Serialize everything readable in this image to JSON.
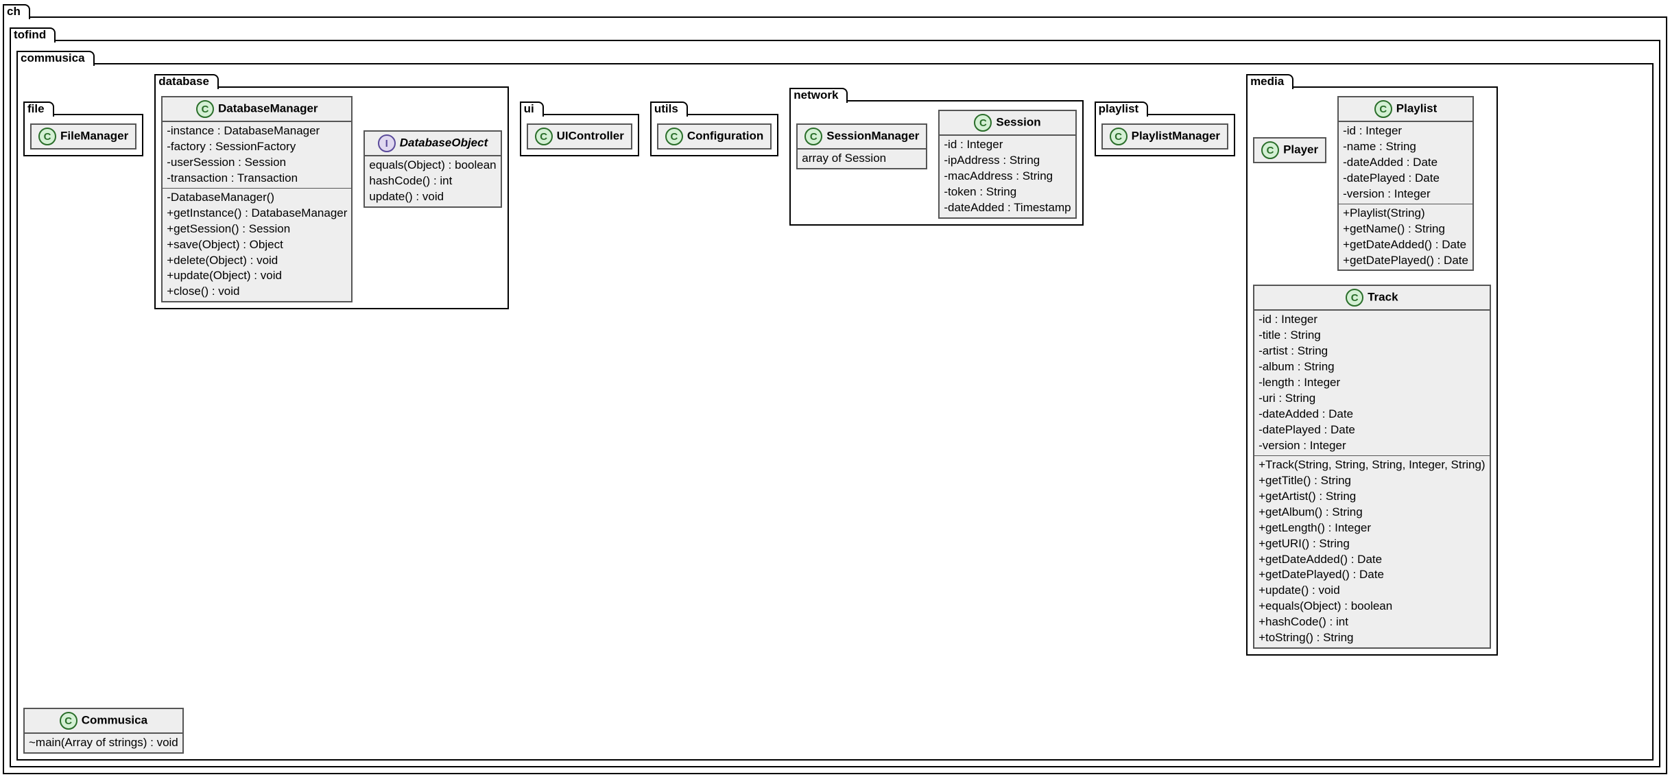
{
  "packages": {
    "ch": "ch",
    "tofind": "tofind",
    "commusica": "commusica",
    "file": "file",
    "database": "database",
    "ui": "ui",
    "utils": "utils",
    "network": "network",
    "playlist": "playlist",
    "media": "media"
  },
  "classes": {
    "FileManager": {
      "name": "FileManager"
    },
    "DatabaseManager": {
      "name": "DatabaseManager",
      "attrs": [
        "-instance : DatabaseManager",
        "-factory : SessionFactory",
        "-userSession : Session",
        "-transaction : Transaction"
      ],
      "ops": [
        "-DatabaseManager()",
        "+getInstance() : DatabaseManager",
        "+getSession() : Session",
        "+save(Object) : Object",
        "+delete(Object) : void",
        "+update(Object) : void",
        "+close() : void"
      ]
    },
    "DatabaseObject": {
      "name": "DatabaseObject",
      "ops": [
        "equals(Object) : boolean",
        "hashCode() : int",
        "update() : void"
      ]
    },
    "UIController": {
      "name": "UIController"
    },
    "Configuration": {
      "name": "Configuration"
    },
    "SessionManager": {
      "name": "SessionManager",
      "attrs": [
        "array of Session"
      ]
    },
    "Session": {
      "name": "Session",
      "attrs": [
        "-id : Integer",
        "-ipAddress : String",
        "-macAddress : String",
        "-token : String",
        "-dateAdded : Timestamp"
      ]
    },
    "PlaylistManager": {
      "name": "PlaylistManager"
    },
    "Player": {
      "name": "Player"
    },
    "Playlist": {
      "name": "Playlist",
      "attrs": [
        "-id : Integer",
        "-name : String",
        "-dateAdded : Date",
        "-datePlayed : Date",
        "-version : Integer"
      ],
      "ops": [
        "+Playlist(String)",
        "+getName() : String",
        "+getDateAdded() : Date",
        "+getDatePlayed() : Date"
      ]
    },
    "Track": {
      "name": "Track",
      "attrs": [
        "-id : Integer",
        "-title : String",
        "-artist : String",
        "-album : String",
        "-length : Integer",
        "-uri : String",
        "-dateAdded : Date",
        "-datePlayed : Date",
        "-version : Integer"
      ],
      "ops": [
        "+Track(String, String, String, Integer, String)",
        "+getTitle() : String",
        "+getArtist() : String",
        "+getAlbum() : String",
        "+getLength() : Integer",
        "+getURI() : String",
        "+getDateAdded() : Date",
        "+getDatePlayed() : Date",
        "+update() : void",
        "+equals(Object) : boolean",
        "+hashCode() : int",
        "+toString() : String"
      ]
    },
    "Commusica": {
      "name": "Commusica",
      "ops": [
        "~main(Array of strings) : void"
      ]
    }
  },
  "chart_data": {
    "type": "uml-class-diagram",
    "packages": [
      {
        "name": "ch",
        "children": [
          {
            "name": "tofind",
            "children": [
              {
                "name": "commusica",
                "classes": [
                  {
                    "name": "Commusica",
                    "type": "class",
                    "operations": [
                      "~main(Array of strings) : void"
                    ]
                  }
                ],
                "children": [
                  {
                    "name": "file",
                    "classes": [
                      {
                        "name": "FileManager",
                        "type": "class"
                      }
                    ]
                  },
                  {
                    "name": "database",
                    "classes": [
                      {
                        "name": "DatabaseManager",
                        "type": "class",
                        "attributes": [
                          "-instance : DatabaseManager",
                          "-factory : SessionFactory",
                          "-userSession : Session",
                          "-transaction : Transaction"
                        ],
                        "operations": [
                          "-DatabaseManager()",
                          "+getInstance() : DatabaseManager",
                          "+getSession() : Session",
                          "+save(Object) : Object",
                          "+delete(Object) : void",
                          "+update(Object) : void",
                          "+close() : void"
                        ]
                      },
                      {
                        "name": "DatabaseObject",
                        "type": "interface",
                        "operations": [
                          "equals(Object) : boolean",
                          "hashCode() : int",
                          "update() : void"
                        ]
                      }
                    ]
                  },
                  {
                    "name": "ui",
                    "classes": [
                      {
                        "name": "UIController",
                        "type": "class"
                      }
                    ]
                  },
                  {
                    "name": "utils",
                    "classes": [
                      {
                        "name": "Configuration",
                        "type": "class"
                      }
                    ]
                  },
                  {
                    "name": "network",
                    "classes": [
                      {
                        "name": "SessionManager",
                        "type": "class",
                        "attributes": [
                          "array of Session"
                        ]
                      },
                      {
                        "name": "Session",
                        "type": "class",
                        "attributes": [
                          "-id : Integer",
                          "-ipAddress : String",
                          "-macAddress : String",
                          "-token : String",
                          "-dateAdded : Timestamp"
                        ]
                      }
                    ]
                  },
                  {
                    "name": "playlist",
                    "classes": [
                      {
                        "name": "PlaylistManager",
                        "type": "class"
                      }
                    ]
                  },
                  {
                    "name": "media",
                    "classes": [
                      {
                        "name": "Player",
                        "type": "class"
                      },
                      {
                        "name": "Playlist",
                        "type": "class",
                        "attributes": [
                          "-id : Integer",
                          "-name : String",
                          "-dateAdded : Date",
                          "-datePlayed : Date",
                          "-version : Integer"
                        ],
                        "operations": [
                          "+Playlist(String)",
                          "+getName() : String",
                          "+getDateAdded() : Date",
                          "+getDatePlayed() : Date"
                        ]
                      },
                      {
                        "name": "Track",
                        "type": "class",
                        "attributes": [
                          "-id : Integer",
                          "-title : String",
                          "-artist : String",
                          "-album : String",
                          "-length : Integer",
                          "-uri : String",
                          "-dateAdded : Date",
                          "-datePlayed : Date",
                          "-version : Integer"
                        ],
                        "operations": [
                          "+Track(String, String, String, Integer, String)",
                          "+getTitle() : String",
                          "+getArtist() : String",
                          "+getAlbum() : String",
                          "+getLength() : Integer",
                          "+getURI() : String",
                          "+getDateAdded() : Date",
                          "+getDatePlayed() : Date",
                          "+update() : void",
                          "+equals(Object) : boolean",
                          "+hashCode() : int",
                          "+toString() : String"
                        ]
                      }
                    ]
                  }
                ]
              }
            ]
          }
        ]
      }
    ]
  }
}
